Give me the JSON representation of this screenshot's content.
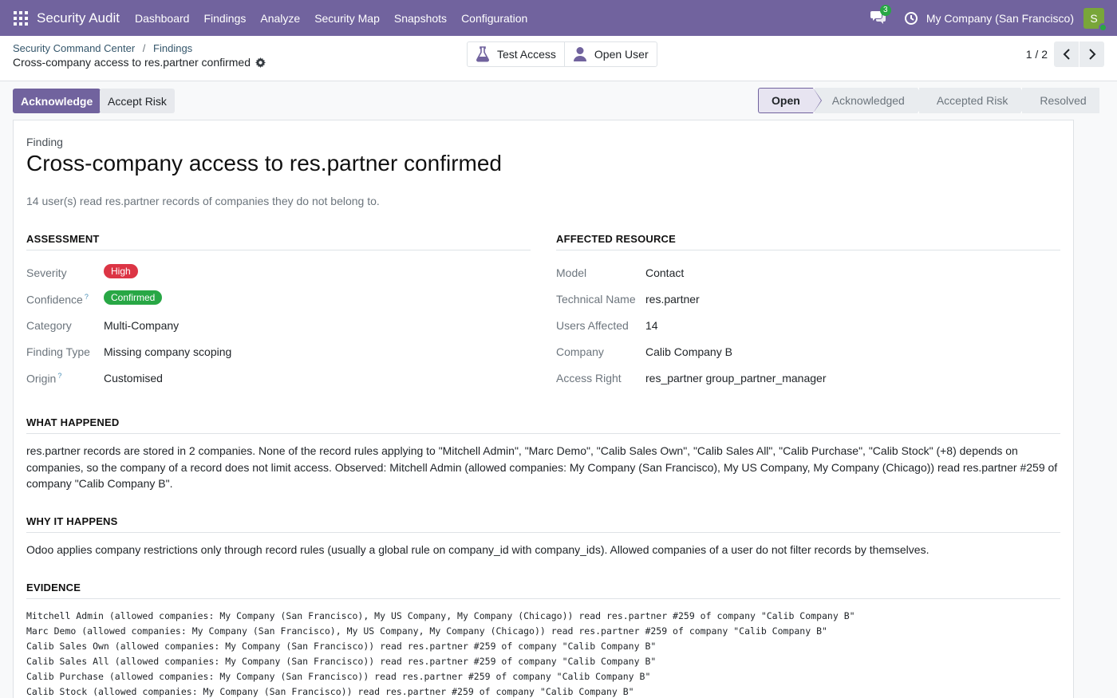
{
  "navbar": {
    "app_name": "Security Audit",
    "menu": [
      "Dashboard",
      "Findings",
      "Analyze",
      "Security Map",
      "Snapshots",
      "Configuration"
    ],
    "chat_count": "3",
    "company": "My Company (San Francisco)",
    "avatar_letter": "S",
    "accent_color": "#71639e"
  },
  "breadcrumb": {
    "parent": "Security Command Center",
    "current": "Findings",
    "separator": "/",
    "record_title": "Cross-company access to res.partner confirmed"
  },
  "smart_buttons": {
    "test_access": "Test Access",
    "open_user": "Open User"
  },
  "pager": {
    "value": "1 / 2"
  },
  "actions": {
    "acknowledge": "Acknowledge",
    "accept_risk": "Accept Risk"
  },
  "stages": [
    "Open",
    "Acknowledged",
    "Accepted Risk",
    "Resolved"
  ],
  "finding": {
    "label": "Finding",
    "title": "Cross-company access to res.partner confirmed",
    "summary": "14 user(s) read res.partner records of companies they do not belong to."
  },
  "assessment": {
    "heading": "ASSESSMENT",
    "severity_label": "Severity",
    "severity": "High",
    "confidence_label": "Confidence",
    "confidence": "Confirmed",
    "category_label": "Category",
    "category": "Multi-Company",
    "finding_type_label": "Finding Type",
    "finding_type": "Missing company scoping",
    "origin_label": "Origin",
    "origin": "Customised",
    "help_mark": "?"
  },
  "resource": {
    "heading": "AFFECTED RESOURCE",
    "model_label": "Model",
    "model": "Contact",
    "technical_label": "Technical Name",
    "technical": "res.partner",
    "users_label": "Users Affected",
    "users": "14",
    "company_label": "Company",
    "company": "Calib Company B",
    "access_label": "Access Right",
    "access": "res_partner group_partner_manager"
  },
  "what_happened": {
    "heading": "WHAT HAPPENED",
    "text": "res.partner records are stored in 2 companies. None of the record rules applying to \"Mitchell Admin\", \"Marc Demo\", \"Calib Sales Own\", \"Calib Sales All\", \"Calib Purchase\", \"Calib Stock\" (+8) depends on companies, so the company of a record does not limit access. Observed: Mitchell Admin (allowed companies: My Company (San Francisco), My US Company, My Company (Chicago)) read res.partner #259 of company \"Calib Company B\"."
  },
  "why_it_happens": {
    "heading": "WHY IT HAPPENS",
    "text": "Odoo applies company restrictions only through record rules (usually a global rule on company_id with company_ids). Allowed companies of a user do not filter records by themselves."
  },
  "evidence": {
    "heading": "EVIDENCE",
    "lines": [
      "Mitchell Admin (allowed companies: My Company (San Francisco), My US Company, My Company (Chicago)) read res.partner #259 of company \"Calib Company B\"",
      "Marc Demo (allowed companies: My Company (San Francisco), My US Company, My Company (Chicago)) read res.partner #259 of company \"Calib Company B\"",
      "Calib Sales Own (allowed companies: My Company (San Francisco)) read res.partner #259 of company \"Calib Company B\"",
      "Calib Sales All (allowed companies: My Company (San Francisco)) read res.partner #259 of company \"Calib Company B\"",
      "Calib Purchase (allowed companies: My Company (San Francisco)) read res.partner #259 of company \"Calib Company B\"",
      "Calib Stock (allowed companies: My Company (San Francisco)) read res.partner #259 of company \"Calib Company B\""
    ]
  }
}
